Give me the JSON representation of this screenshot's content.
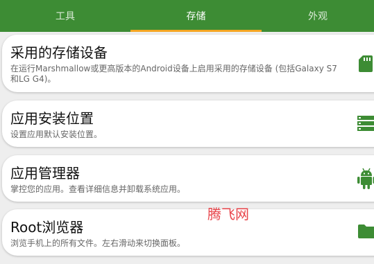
{
  "tabs": [
    {
      "label": "工具"
    },
    {
      "label": "存储"
    },
    {
      "label": "外观"
    }
  ],
  "cards": [
    {
      "title": "采用的存储设备",
      "subtitle": "在运行Marshmallow或更高版本的Android设备上启用采用的存储设备 (包括Galaxy S7和LG G4)。",
      "icon": "sd-card-icon"
    },
    {
      "title": "应用安装位置",
      "subtitle": "设置应用默认安装位置。",
      "icon": "storage-icon"
    },
    {
      "title": "应用管理器",
      "subtitle": "掌控您的应用。查看详细信息并卸载系统应用。",
      "icon": "android-icon"
    },
    {
      "title": "Root浏览器",
      "subtitle": "浏览手机上的所有文件。左右滑动来切换面板。",
      "icon": "folder-icon"
    }
  ],
  "watermark": "腾飞网",
  "colors": {
    "primary": "#3d8c34",
    "indicator": "#f5a623",
    "watermark": "#e8444a"
  }
}
